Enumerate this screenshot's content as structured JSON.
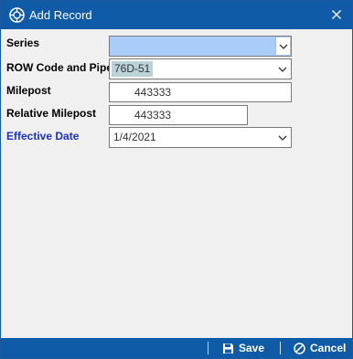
{
  "window": {
    "title": "Add Record",
    "title_icon": "app-logo-icon",
    "close_icon": "close-icon"
  },
  "form": {
    "series": {
      "label": "Series",
      "value": ""
    },
    "row_code_pipe": {
      "label": "ROW Code and Pipe",
      "value": "76D-51"
    },
    "milepost": {
      "label": "Milepost",
      "value": "443333"
    },
    "relative_milepost": {
      "label": "Relative Milepost",
      "value": "443333"
    },
    "effective_date": {
      "label": "Effective Date",
      "value": "1/4/2021"
    }
  },
  "footer": {
    "save_label": "Save",
    "save_icon": "floppy-disk-icon",
    "cancel_label": "Cancel",
    "cancel_icon": "cancel-circle-icon"
  },
  "colors": {
    "titlebar": "#0f5ba7",
    "series_highlight": "#a9cdf8",
    "effective_date_label": "#1a31c8"
  }
}
